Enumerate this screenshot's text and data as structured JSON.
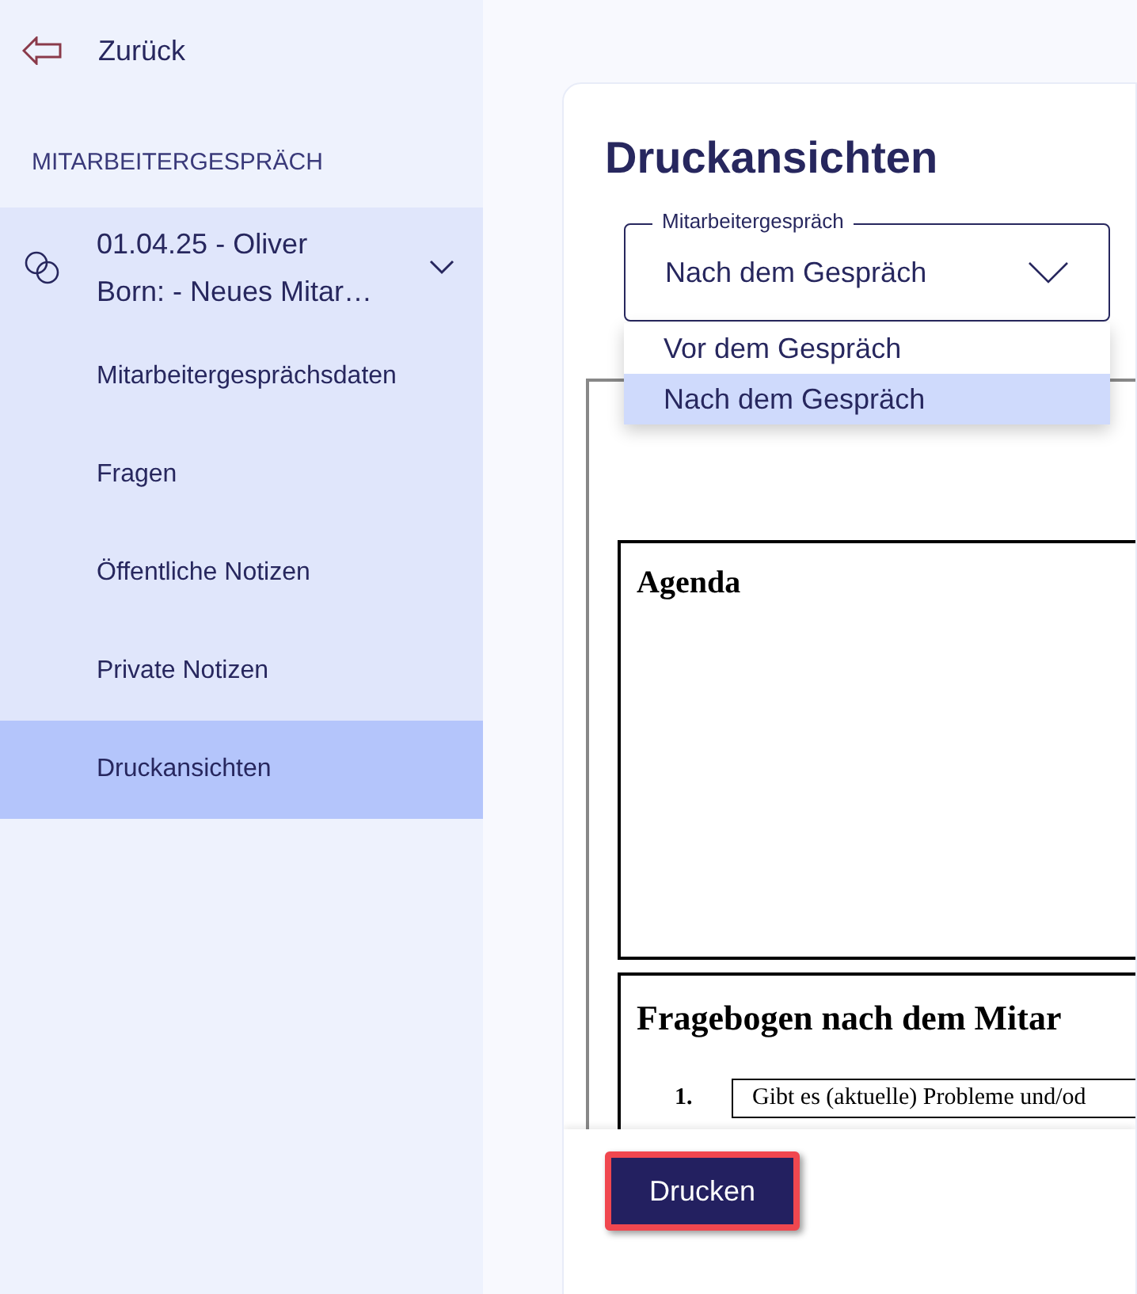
{
  "sidebar": {
    "back": "Zurück",
    "section_title": "MITARBEITERGESPRÄCH",
    "conversation": {
      "title": "01.04.25 - Oliver Born: - Neues Mitar…",
      "expanded": true
    },
    "items": [
      {
        "label": "Mitarbeitergesprächsdaten",
        "selected": false
      },
      {
        "label": "Fragen",
        "selected": false
      },
      {
        "label": "Öffentliche Notizen",
        "selected": false
      },
      {
        "label": "Private Notizen",
        "selected": false
      },
      {
        "label": "Druckansichten",
        "selected": true
      }
    ]
  },
  "main": {
    "title": "Druckansichten",
    "select": {
      "label": "Mitarbeitergespräch",
      "value": "Nach dem Gespräch",
      "expanded": true,
      "options": [
        {
          "label": "Vor dem Gespräch",
          "selected": false
        },
        {
          "label": "Nach dem Gespräch",
          "selected": true
        }
      ]
    },
    "preview": {
      "agenda_heading": "Agenda",
      "questionnaire_heading": "Fragebogen nach dem Mitar",
      "question_number": "1.",
      "question_text": "Gibt es (aktuelle) Probleme und/od"
    },
    "print_button": {
      "label": "Drucken",
      "highlighted": true
    }
  }
}
